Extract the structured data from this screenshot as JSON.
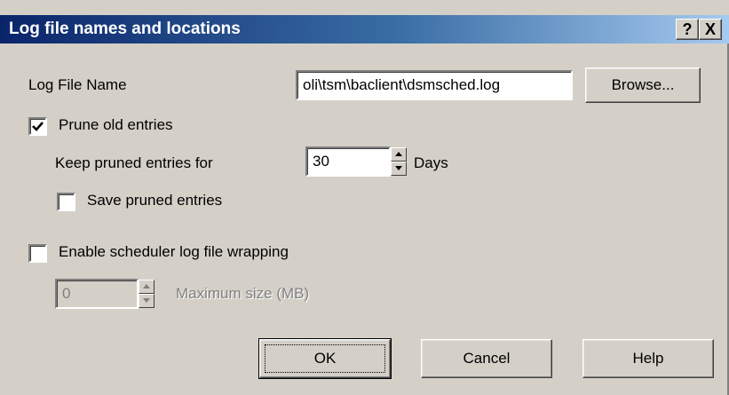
{
  "window": {
    "title": "Log file names and locations",
    "help_glyph": "?",
    "close_glyph": "X"
  },
  "log_file": {
    "label": "Log File Name",
    "value": "oli\\tsm\\baclient\\dsmsched.log",
    "browse_label": "Browse..."
  },
  "prune": {
    "label": "Prune old entries",
    "checked": true,
    "keep_label": "Keep pruned entries for",
    "keep_value": "30",
    "days_label": "Days",
    "save_label": "Save pruned entries",
    "save_checked": false
  },
  "wrap": {
    "label": "Enable scheduler log file wrapping",
    "checked": false,
    "size_value": "0",
    "size_label": "Maximum size (MB)"
  },
  "buttons": {
    "ok": "OK",
    "cancel": "Cancel",
    "help": "Help"
  },
  "icons": {
    "checkmark": "checkmark-icon",
    "spin_up": "triangle-up-icon",
    "spin_down": "triangle-down-icon"
  }
}
